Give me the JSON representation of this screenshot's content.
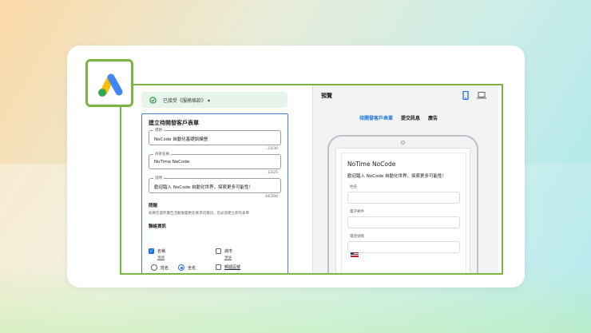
{
  "terms": {
    "text": "已接受《服務條款》",
    "caret": "▾"
  },
  "form": {
    "title": "建立待開發客戶表單",
    "fields": [
      {
        "label": "標題",
        "value": "NoCode 自動化基礎訓練營",
        "count": "23/30"
      },
      {
        "label": "商家名稱",
        "value": "NoTime NoCode",
        "count": "13/25"
      },
      {
        "label": "說明",
        "value": "歡迎踏入 NoCode 自動化世界，探索更多可能性！",
        "count": "44/200"
      }
    ],
    "questions_title": "問題",
    "questions_help": "如要在儲存廣告活動後變更您要求的資訊，您必須建立新的表單",
    "contact_title": "聯絡資訊",
    "name_label": "名稱",
    "name_sub": "預填",
    "city_label": "城市",
    "city_sub": "預填",
    "radio_first": "姓名",
    "radio_full": "全名",
    "zip_label": "郵遞區號"
  },
  "preview": {
    "title": "預覽",
    "tabs": [
      "待開發客戶表單",
      "提交訊息",
      "廣告"
    ],
    "business": "NoTime NoCode",
    "desc": "歡迎踏入 NoCode 自動化世界，探索更多可能性！",
    "fields": [
      "姓名",
      "電子郵件",
      "電話號碼"
    ]
  }
}
